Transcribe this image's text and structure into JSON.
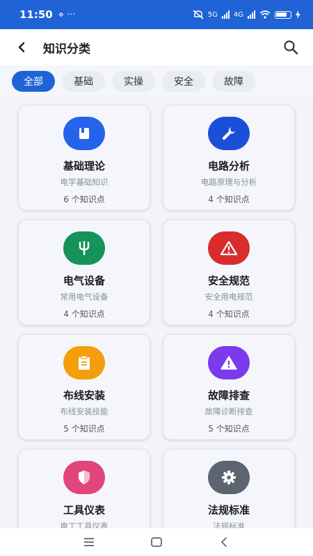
{
  "status": {
    "time": "11:50",
    "extra": "⋄ ···",
    "net1": "5G",
    "net2": "4G"
  },
  "header": {
    "title": "知识分类"
  },
  "chips": [
    {
      "label": "全部",
      "active": true
    },
    {
      "label": "基础",
      "active": false
    },
    {
      "label": "实操",
      "active": false
    },
    {
      "label": "安全",
      "active": false
    },
    {
      "label": "故障",
      "active": false
    }
  ],
  "cards": [
    {
      "title": "基础理论",
      "subtitle": "电学基础知识",
      "count": "6 个知识点",
      "icon": "book-icon",
      "color": "#2563eb"
    },
    {
      "title": "电路分析",
      "subtitle": "电路原理与分析",
      "count": "4 个知识点",
      "icon": "wrench-icon",
      "color": "#1d4ed8"
    },
    {
      "title": "电气设备",
      "subtitle": "常用电气设备",
      "count": "4 个知识点",
      "icon": "plug-icon",
      "color": "#15935a"
    },
    {
      "title": "安全规范",
      "subtitle": "安全用电规范",
      "count": "4 个知识点",
      "icon": "warning-icon",
      "color": "#d92d2d"
    },
    {
      "title": "布线安装",
      "subtitle": "布线安装技能",
      "count": "5 个知识点",
      "icon": "clipboard-icon",
      "color": "#f59e0b"
    },
    {
      "title": "故障排查",
      "subtitle": "故障诊断排查",
      "count": "5 个知识点",
      "icon": "warning-icon",
      "color": "#7c3aed"
    },
    {
      "title": "工具仪表",
      "subtitle": "电工工具仪表",
      "count": "",
      "icon": "shield-icon",
      "color": "#e0457b"
    },
    {
      "title": "法规标准",
      "subtitle": "法规标准",
      "count": "",
      "icon": "gear-icon",
      "color": "#5b6470"
    }
  ]
}
